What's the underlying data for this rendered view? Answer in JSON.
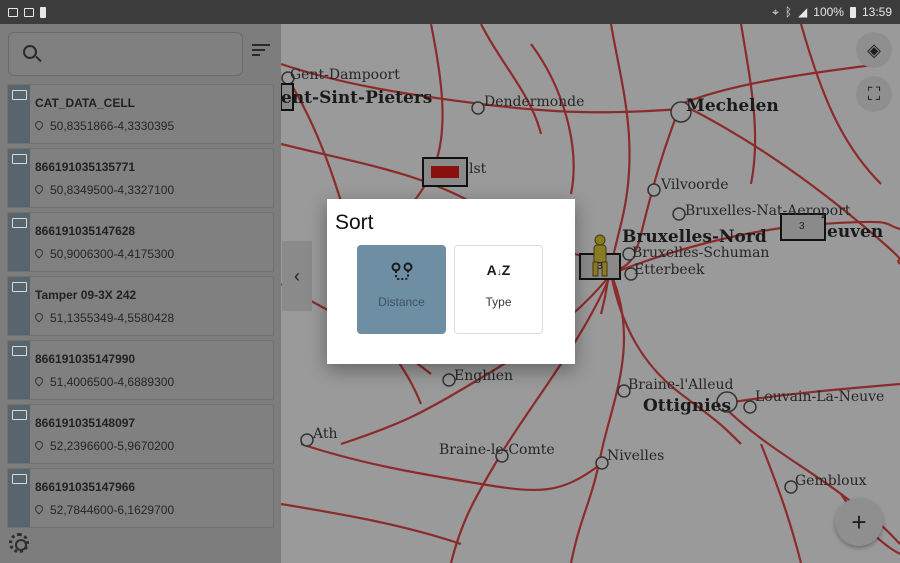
{
  "statusbar": {
    "battery": "100%",
    "time": "13:59"
  },
  "search": {
    "placeholder": ""
  },
  "list": [
    {
      "title": "CAT_DATA_CELL",
      "coords": "50,8351866-4,3330395"
    },
    {
      "title": "866191035135771",
      "coords": "50,8349500-4,3327100"
    },
    {
      "title": "866191035147628",
      "coords": "50,9006300-4,4175300"
    },
    {
      "title": "Tamper 09-3X 242",
      "coords": "51,1355349-4,5580428"
    },
    {
      "title": "866191035147990",
      "coords": "51,4006500-4,6889300"
    },
    {
      "title": "866191035148097",
      "coords": "52,2396600-5,9670200"
    },
    {
      "title": "866191035147966",
      "coords": "52,7844600-6,1629700"
    }
  ],
  "map": {
    "cities": [
      {
        "name": "Gent-Dampoort"
      },
      {
        "name": "ent-Sint-Pieters"
      },
      {
        "name": "Dendermonde"
      },
      {
        "name": "Mechelen"
      },
      {
        "name": "lst"
      },
      {
        "name": "Vilvoorde"
      },
      {
        "name": "Bruxelles-Nat-Aeroport"
      },
      {
        "name": "Bruxelles-Nord"
      },
      {
        "name": "Bruxelles-Schuman"
      },
      {
        "name": "Etterbeek"
      },
      {
        "name": "euven"
      },
      {
        "name": "Enghien"
      },
      {
        "name": "Braine-l'Alleud"
      },
      {
        "name": "Ottignies"
      },
      {
        "name": "Louvain-La-Neuve"
      },
      {
        "name": "Ath"
      },
      {
        "name": "Braine-le-Comte"
      },
      {
        "name": "Nivelles"
      },
      {
        "name": "Gembloux"
      }
    ],
    "markers": [
      {
        "label": ""
      },
      {
        "label": "3"
      },
      {
        "label": "3"
      }
    ],
    "add_label": "+",
    "collapse_label": "‹"
  },
  "dialog": {
    "title": "Sort",
    "options": [
      {
        "label": "Distance",
        "icon": "distance-icon",
        "selected": true
      },
      {
        "label": "Type",
        "icon": "sort-az-icon",
        "selected": false
      }
    ]
  },
  "colors": {
    "rail": "#b30000",
    "selected_option": "#6d8ea3",
    "status_bar": "#3c3c3c"
  }
}
